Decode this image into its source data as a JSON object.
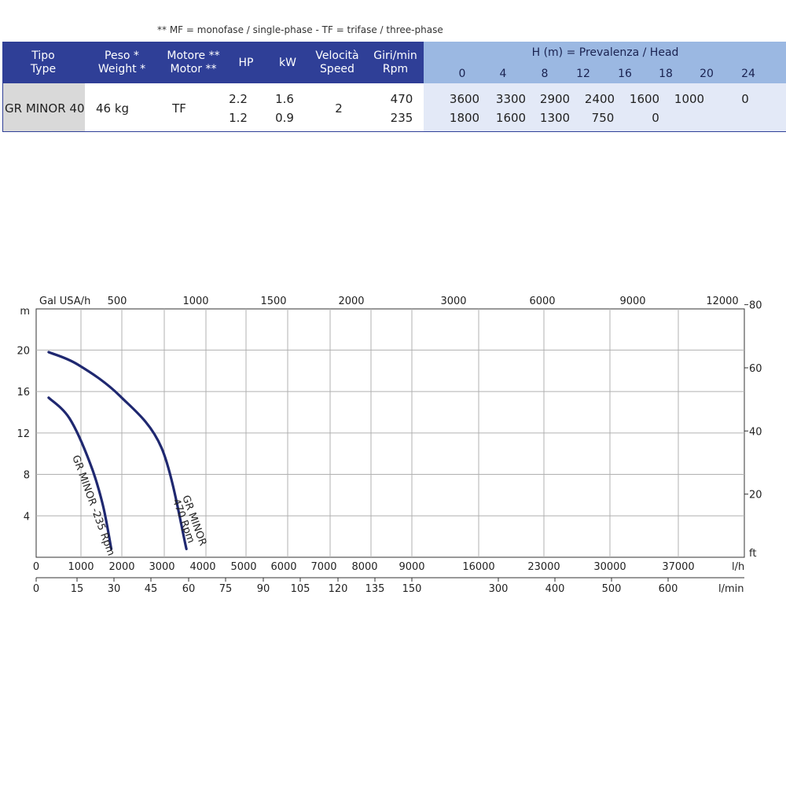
{
  "note": "** MF = monofase / single-phase - TF = trifase / three-phase",
  "table": {
    "headers": {
      "type": [
        "Tipo",
        "Type"
      ],
      "weight": [
        "Peso *",
        "Weight *"
      ],
      "motor": [
        "Motore **",
        "Motor **"
      ],
      "hp": "HP",
      "kw": "kW",
      "speed": [
        "Velocità",
        "Speed"
      ],
      "rpm": [
        "Giri/min",
        "Rpm"
      ],
      "head": "H (m) = Prevalenza / Head"
    },
    "head_values": [
      "0",
      "4",
      "8",
      "12",
      "16",
      "18",
      "20",
      "24"
    ],
    "row": {
      "type": "GR  MINOR 40",
      "weight": "46 kg",
      "motor": "TF",
      "hp": [
        "2.2",
        "1.2"
      ],
      "kw": [
        "1.6",
        "0.9"
      ],
      "speed": "2",
      "rpm": [
        "470",
        "235"
      ],
      "flow_470": [
        "3600",
        "3300",
        "2900",
        "2400",
        "1600",
        "1000",
        "",
        "0"
      ],
      "flow_235": [
        "1800",
        "1600",
        "1300",
        "750",
        "0",
        "",
        "",
        ""
      ]
    }
  },
  "colors": {
    "header_dark": "#2f3f97",
    "header_light": "#9bb8e2",
    "row_light": "#e3e9f7",
    "curve": "#1f2870",
    "grid": "#b0b0b0"
  },
  "chart_data": {
    "type": "line",
    "x_unit": "l/h",
    "y_unit": "m",
    "ylim": [
      0,
      24
    ],
    "y_ticks": [
      "20",
      "16",
      "12",
      "8",
      "4"
    ],
    "y_right_unit": "ft",
    "y_right_ticks": [
      "80",
      "60",
      "40",
      "20"
    ],
    "x_top_unit": "Gal USA/h",
    "x_top_ticks": [
      "500",
      "1000",
      "1500",
      "2000",
      "3000",
      "6000",
      "9000",
      "12000"
    ],
    "x_ticks_lh": [
      "0",
      "1000",
      "2000",
      "3000",
      "4000",
      "5000",
      "6000",
      "7000",
      "8000",
      "9000",
      "16000",
      "23000",
      "30000",
      "37000"
    ],
    "x_ticks_lmin_unit": "l/min",
    "x_ticks_lmin": [
      "0",
      "15",
      "30",
      "45",
      "60",
      "75",
      "90",
      "105",
      "120",
      "135",
      "150",
      "300",
      "400",
      "500",
      "600"
    ],
    "grid": true,
    "series": [
      {
        "name": "GR MINOR 470 Rpm",
        "label_lines": [
          "GR MINOR",
          "470 Rpm"
        ],
        "points": [
          [
            300,
            19.8
          ],
          [
            1000,
            18.6
          ],
          [
            2000,
            15.6
          ],
          [
            3000,
            10.6
          ],
          [
            3600,
            0.8
          ]
        ]
      },
      {
        "name": "GR MINOR -235 Rpm",
        "label_lines": [
          "GR MINOR -235 Rpm"
        ],
        "points": [
          [
            300,
            15.4
          ],
          [
            800,
            13.4
          ],
          [
            1300,
            9.0
          ],
          [
            1600,
            5.0
          ],
          [
            1800,
            0.8
          ]
        ]
      }
    ]
  }
}
